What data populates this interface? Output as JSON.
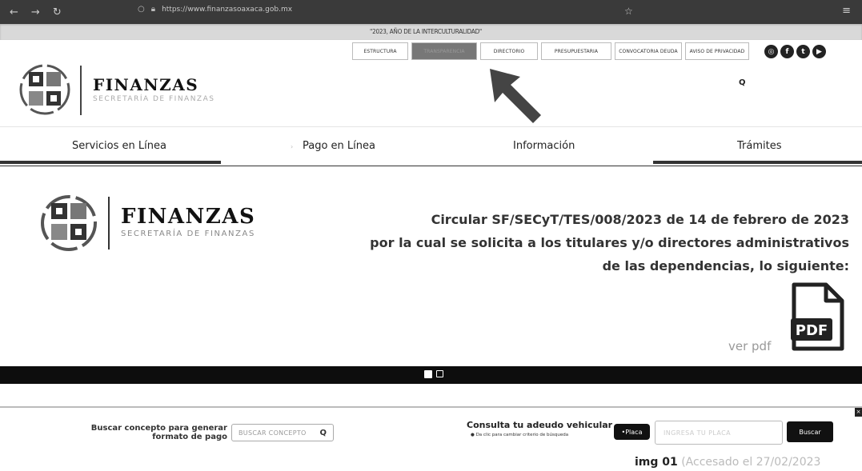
{
  "browser": {
    "back_icon": "arrow-left",
    "forward_icon": "arrow-right",
    "reload_icon": "reload",
    "url": "https://www.finanzasoaxaca.gob.mx",
    "bookmark_icon": "star",
    "menu_icon": "hamburger"
  },
  "header": {
    "year_banner": "\"2023, AÑO DE LA INTERCULTURALIDAD\"",
    "top_nav": [
      {
        "label": "ESTRUCTURA",
        "active": false
      },
      {
        "label": "TRANSPARENCIA",
        "active": true
      },
      {
        "label": "DIRECTORIO",
        "active": false
      },
      {
        "label": "PRESUPUESTARIA",
        "active": false
      },
      {
        "label": "CONVOCATORIA DEUDA",
        "active": false
      },
      {
        "label": "AVISO DE PRIVACIDAD",
        "active": false
      }
    ],
    "social": [
      "instagram-icon",
      "facebook-icon",
      "twitter-icon",
      "youtube-icon"
    ],
    "brand_title": "FINANZAS",
    "brand_subtitle": "SECRETARÍA DE FINANZAS",
    "search_placeholder": ""
  },
  "main_nav": [
    {
      "label": "Servicios en Línea"
    },
    {
      "label": "Pago en Línea"
    },
    {
      "label": "Información"
    },
    {
      "label": "Trámites"
    }
  ],
  "slider": {
    "brand_title": "FINANZAS",
    "brand_subtitle": "SECRETARÍA DE FINANZAS",
    "circular_line1": "Circular SF/SECyT/TES/008/2023 de 14 de febrero de 2023",
    "circular_line2": "por la cual se solicita a los titulares y/o directores administrativos",
    "circular_line3": "de las dependencias, lo siguiente:",
    "pdf_label": "PDF",
    "ver_pdf": "ver pdf"
  },
  "bottom": {
    "buscar_label": "Buscar concepto para generar formato de pago",
    "buscar_placeholder": "BUSCAR CONCEPTO",
    "consulta_title": "Consulta tu adeudo vehicular",
    "consulta_sub": "Da clic para cambiar criterio de búsqueda",
    "placa_btn": "Placa",
    "placa_placeholder": "INGRESA TU PLACA",
    "buscar_btn": "Buscar",
    "close": "×"
  },
  "caption": {
    "bold": "img 01",
    "rest": " (Accesado el 27/02/2023"
  },
  "colors": {
    "chrome_bg": "#3a3a3a",
    "dark": "#111111",
    "active_tab": "#777777"
  }
}
